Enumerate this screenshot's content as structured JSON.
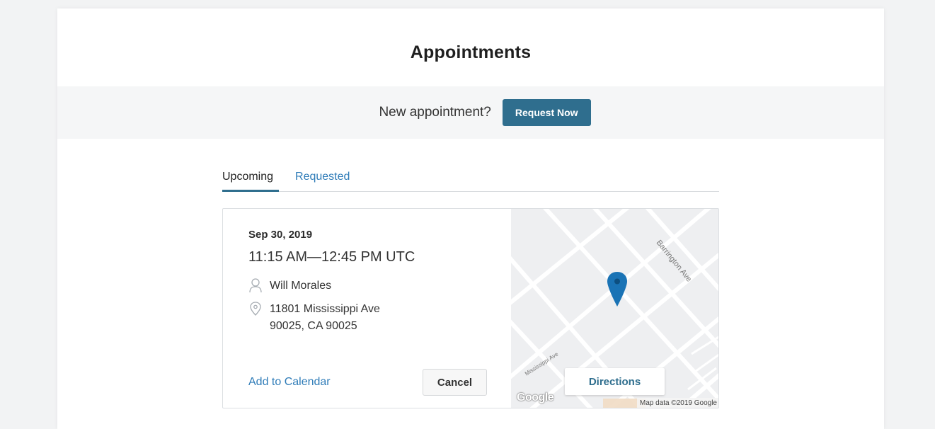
{
  "page": {
    "title": "Appointments"
  },
  "request_bar": {
    "prompt": "New appointment?",
    "button_label": "Request Now"
  },
  "tabs": [
    {
      "label": "Upcoming",
      "active": true
    },
    {
      "label": "Requested",
      "active": false
    }
  ],
  "appointment": {
    "date": "Sep 30, 2019",
    "time": "11:15 AM—12:45 PM UTC",
    "provider": "Will Morales",
    "address_line1": "11801 Mississippi Ave",
    "address_line2": "90025, CA 90025",
    "add_to_calendar_label": "Add to Calendar",
    "cancel_label": "Cancel"
  },
  "map": {
    "directions_label": "Directions",
    "logo_text": "Google",
    "attribution": "Map data ©2019 Google",
    "street_barrington": "Barrington Ave",
    "street_mississippi": "Mississippi Ave",
    "pin_color": "#1a73b5"
  },
  "colors": {
    "accent": "#2f6e8e",
    "link": "#2f7cb8"
  },
  "icons": {
    "person": "person-icon",
    "location": "location-pin-icon",
    "map_marker": "map-marker-icon"
  }
}
